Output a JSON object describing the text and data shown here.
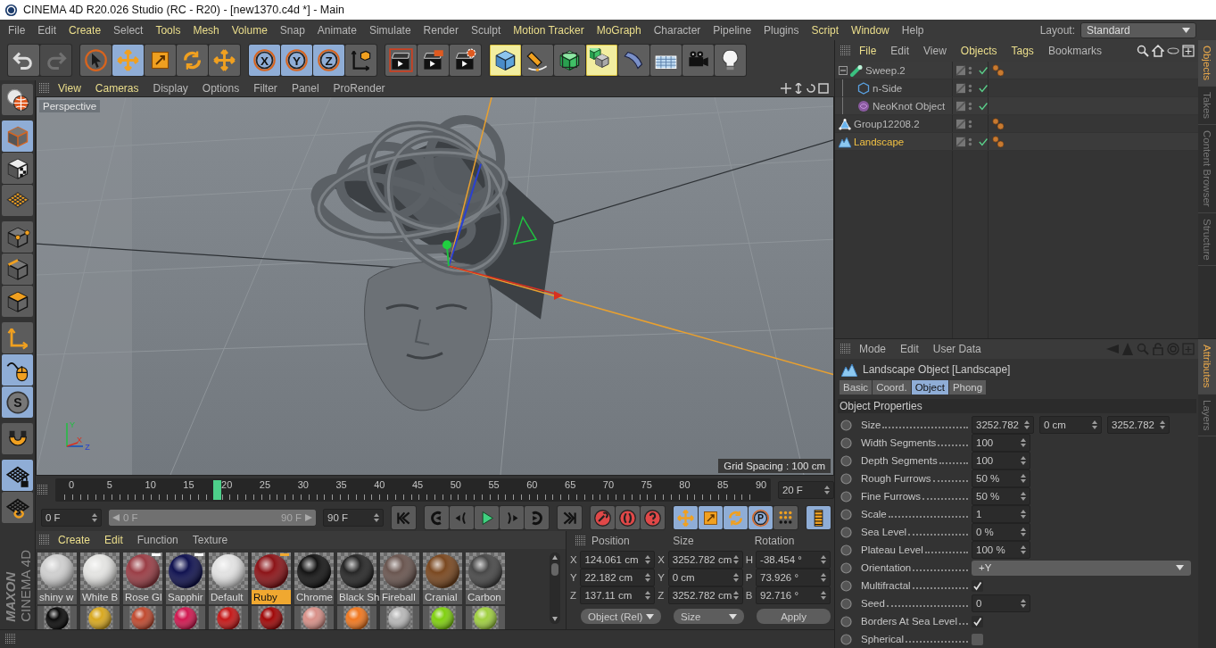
{
  "window": {
    "title": "CINEMA 4D R20.026 Studio (RC - R20) - [new1370.c4d *] - Main"
  },
  "menu_bar": {
    "items": [
      {
        "label": "File",
        "highlight": false
      },
      {
        "label": "Edit",
        "highlight": false
      },
      {
        "label": "Create",
        "highlight": true
      },
      {
        "label": "Select",
        "highlight": false
      },
      {
        "label": "Tools",
        "highlight": true
      },
      {
        "label": "Mesh",
        "highlight": true
      },
      {
        "label": "Volume",
        "highlight": true
      },
      {
        "label": "Snap",
        "highlight": false
      },
      {
        "label": "Animate",
        "highlight": false
      },
      {
        "label": "Simulate",
        "highlight": false
      },
      {
        "label": "Render",
        "highlight": false
      },
      {
        "label": "Sculpt",
        "highlight": false
      },
      {
        "label": "Motion Tracker",
        "highlight": true
      },
      {
        "label": "MoGraph",
        "highlight": true
      },
      {
        "label": "Character",
        "highlight": false
      },
      {
        "label": "Pipeline",
        "highlight": false
      },
      {
        "label": "Plugins",
        "highlight": false
      },
      {
        "label": "Script",
        "highlight": true
      },
      {
        "label": "Window",
        "highlight": true
      },
      {
        "label": "Help",
        "highlight": false
      }
    ],
    "layout_label": "Layout:",
    "layout_value": "Standard"
  },
  "toolbar": {
    "groups": [
      [
        {
          "kind": "undo",
          "selected": false,
          "highlighted": false,
          "disabled": false
        },
        {
          "kind": "redo",
          "selected": false,
          "highlighted": false,
          "disabled": true
        }
      ],
      [
        {
          "kind": "select",
          "selected": false,
          "highlighted": false,
          "disabled": false
        },
        {
          "kind": "move",
          "selected": true,
          "highlighted": false,
          "disabled": false
        },
        {
          "kind": "scale",
          "selected": false,
          "highlighted": false,
          "disabled": false
        },
        {
          "kind": "rotate",
          "selected": false,
          "highlighted": false,
          "disabled": false
        },
        {
          "kind": "recent",
          "selected": false,
          "highlighted": false,
          "disabled": false
        }
      ],
      [
        {
          "kind": "axis",
          "label": "X",
          "selected": true,
          "highlighted": false,
          "disabled": false
        },
        {
          "kind": "axis",
          "label": "Y",
          "selected": true,
          "highlighted": false,
          "disabled": false
        },
        {
          "kind": "axis",
          "label": "Z",
          "selected": true,
          "highlighted": false,
          "disabled": false
        },
        {
          "kind": "coords",
          "selected": false,
          "highlighted": false,
          "disabled": false
        }
      ],
      [
        {
          "kind": "renderview",
          "selected": false,
          "highlighted": false,
          "disabled": false
        },
        {
          "kind": "render",
          "selected": false,
          "highlighted": false,
          "disabled": false
        },
        {
          "kind": "rendersettings",
          "selected": false,
          "highlighted": false,
          "disabled": false
        }
      ],
      [
        {
          "kind": "cube",
          "selected": false,
          "highlighted": true,
          "disabled": false
        },
        {
          "kind": "pen",
          "selected": false,
          "highlighted": false,
          "disabled": false
        },
        {
          "kind": "subdiv",
          "selected": false,
          "highlighted": false,
          "disabled": false
        },
        {
          "kind": "cloner",
          "selected": false,
          "highlighted": true,
          "disabled": false
        },
        {
          "kind": "deformer",
          "selected": false,
          "highlighted": false,
          "disabled": false
        },
        {
          "kind": "floor",
          "selected": false,
          "highlighted": false,
          "disabled": false
        },
        {
          "kind": "camera",
          "selected": false,
          "highlighted": false,
          "disabled": false
        },
        {
          "kind": "light",
          "selected": false,
          "highlighted": false,
          "disabled": false
        }
      ]
    ]
  },
  "left_toolbar": {
    "groups": [
      [
        {
          "kind": "editable",
          "selected": false
        }
      ],
      [
        {
          "kind": "model",
          "selected": true
        },
        {
          "kind": "texture",
          "selected": false
        },
        {
          "kind": "workplane",
          "selected": false
        }
      ],
      [
        {
          "kind": "points",
          "selected": false
        },
        {
          "kind": "edges",
          "selected": false
        },
        {
          "kind": "polygons",
          "selected": false
        }
      ],
      [
        {
          "kind": "axismode",
          "selected": false
        },
        {
          "kind": "tweak",
          "selected": true
        },
        {
          "kind": "solo",
          "label": "S",
          "selected": true
        }
      ],
      [
        {
          "kind": "snap",
          "selected": false
        }
      ],
      [
        {
          "kind": "lockplane",
          "selected": true
        },
        {
          "kind": "alignplane",
          "selected": false
        }
      ]
    ]
  },
  "logo": {
    "brand": "MAXON",
    "product": "CINEMA 4D"
  },
  "viewport": {
    "menu": [
      {
        "label": "View",
        "highlight": true
      },
      {
        "label": "Cameras",
        "highlight": true
      },
      {
        "label": "Display",
        "highlight": false
      },
      {
        "label": "Options",
        "highlight": false
      },
      {
        "label": "Filter",
        "highlight": false
      },
      {
        "label": "Panel",
        "highlight": false
      },
      {
        "label": "ProRender",
        "highlight": false
      }
    ],
    "camera": "Perspective",
    "axis_labels": [
      "Y",
      "X",
      "Z"
    ],
    "grid_spacing": "Grid Spacing : 100 cm"
  },
  "timeline": {
    "ticks": [
      "0",
      "5",
      "10",
      "15",
      "20",
      "25",
      "30",
      "35",
      "40",
      "45",
      "50",
      "55",
      "60",
      "65",
      "70",
      "75",
      "80",
      "85",
      "90"
    ],
    "playhead": {
      "level": 0.2222
    },
    "current_frame": "20 F"
  },
  "transport": {
    "start_field": "0 F",
    "range_start": "0 F",
    "range_end": "90 F",
    "range": {
      "level": 1
    },
    "end_field": "90 F",
    "groups": [
      [
        {
          "kind": "gostart",
          "selected": false
        }
      ],
      [
        {
          "kind": "prevkey",
          "selected": false
        },
        {
          "kind": "prevframe",
          "selected": false
        },
        {
          "kind": "play",
          "selected": false
        },
        {
          "kind": "nextframe",
          "selected": false
        },
        {
          "kind": "nextkey",
          "selected": false
        }
      ],
      [
        {
          "kind": "goend",
          "selected": false
        }
      ],
      [
        {
          "kind": "record",
          "selected": false
        },
        {
          "kind": "autokey",
          "selected": false
        },
        {
          "kind": "keyselection",
          "selected": false
        }
      ],
      [
        {
          "kind": "keymove",
          "selected": true
        },
        {
          "kind": "keyscale",
          "selected": true
        },
        {
          "kind": "keyrotate",
          "selected": true
        },
        {
          "kind": "keyparam",
          "label": "P",
          "selected": true
        },
        {
          "kind": "keypla",
          "selected": false
        }
      ],
      [
        {
          "kind": "film",
          "selected": true
        }
      ]
    ]
  },
  "materials": {
    "menu": [
      {
        "label": "Create",
        "highlight": true
      },
      {
        "label": "Edit",
        "highlight": true
      },
      {
        "label": "Function",
        "highlight": false
      },
      {
        "label": "Texture",
        "highlight": false
      }
    ],
    "items": [
      {
        "name": "shiny w",
        "color": "#cfcfcf",
        "selected": false,
        "marked": false
      },
      {
        "name": "White B",
        "color": "#e4e4e2",
        "selected": false,
        "marked": false
      },
      {
        "name": "Rose Gl",
        "color": "#9a3e46",
        "selected": false,
        "marked": true
      },
      {
        "name": "Sapphir",
        "color": "#101250",
        "selected": false,
        "marked": true
      },
      {
        "name": "Default",
        "color": "#e2e2e2",
        "selected": false,
        "marked": false
      },
      {
        "name": "Ruby",
        "color": "#8c1418",
        "selected": true,
        "marked": true
      },
      {
        "name": "Chrome",
        "color": "#141414",
        "selected": false,
        "marked": false
      },
      {
        "name": "Black Sh",
        "color": "#262626",
        "selected": false,
        "marked": false
      },
      {
        "name": "Fireball",
        "color": "#6a5650",
        "selected": false,
        "marked": false
      },
      {
        "name": "Cranial",
        "color": "#7a4820",
        "selected": false,
        "marked": false
      },
      {
        "name": "Carbon",
        "color": "#484848",
        "selected": false,
        "marked": false
      }
    ],
    "more_items": [
      {
        "color": "#0a0a0a"
      },
      {
        "color": "#d8a820"
      },
      {
        "color": "#c04a30"
      },
      {
        "color": "#d01850"
      },
      {
        "color": "#c41818"
      },
      {
        "color": "#a00808"
      },
      {
        "color": "#d89088"
      },
      {
        "color": "#f07820"
      },
      {
        "color": "#b8b8b8"
      },
      {
        "color": "#80d010"
      },
      {
        "color": "#a0d040"
      }
    ]
  },
  "coordinates": {
    "headers": [
      "Position",
      "Size",
      "Rotation"
    ],
    "rows": [
      [
        {
          "axis": "X",
          "value": "124.061 cm"
        },
        {
          "axis": "X",
          "value": "3252.782 cm"
        },
        {
          "axis": "H",
          "value": "-38.454 °"
        }
      ],
      [
        {
          "axis": "Y",
          "value": "22.182 cm"
        },
        {
          "axis": "Y",
          "value": "0 cm"
        },
        {
          "axis": "P",
          "value": "73.926 °"
        }
      ],
      [
        {
          "axis": "Z",
          "value": "137.11 cm"
        },
        {
          "axis": "Z",
          "value": "3252.782 cm"
        },
        {
          "axis": "B",
          "value": "92.716 °"
        }
      ]
    ],
    "mode": "Object (Rel)",
    "size_mode": "Size",
    "apply": "Apply"
  },
  "object_manager": {
    "menu": [
      {
        "label": "File",
        "highlight": true
      },
      {
        "label": "Edit",
        "highlight": false
      },
      {
        "label": "View",
        "highlight": false
      },
      {
        "label": "Objects",
        "highlight": true
      },
      {
        "label": "Tags",
        "highlight": true
      },
      {
        "label": "Bookmarks",
        "highlight": false
      }
    ],
    "objects": [
      {
        "name": "Sweep.2",
        "kind": "sweep",
        "selected": false,
        "enabled": true,
        "tag": true,
        "expanded": true,
        "children": [
          {
            "name": "n-Side",
            "kind": "spline",
            "selected": false,
            "enabled": true,
            "tag": false
          },
          {
            "name": "NeoKnot Object",
            "kind": "knot",
            "selected": false,
            "enabled": true,
            "tag": false
          }
        ]
      },
      {
        "name": "Group12208.2",
        "kind": "group",
        "selected": false,
        "enabled": false,
        "tag": true
      },
      {
        "name": "Landscape",
        "kind": "landscape",
        "selected": true,
        "enabled": true,
        "tag": true
      }
    ],
    "side_tabs": [
      {
        "label": "Objects",
        "selected": true
      },
      {
        "label": "Takes",
        "selected": false
      },
      {
        "label": "Content Browser",
        "selected": false
      },
      {
        "label": "Structure",
        "selected": false
      }
    ]
  },
  "attributes": {
    "menu": [
      {
        "label": "Mode",
        "highlight": false
      },
      {
        "label": "Edit",
        "highlight": false
      },
      {
        "label": "User Data",
        "highlight": false
      }
    ],
    "title": "Landscape Object [Landscape]",
    "tabs": [
      {
        "label": "Basic",
        "selected": false
      },
      {
        "label": "Coord.",
        "selected": false
      },
      {
        "label": "Object",
        "selected": true
      },
      {
        "label": "Phong",
        "selected": false
      }
    ],
    "section": "Object Properties",
    "properties": [
      {
        "label": "Size",
        "kind": "vector",
        "values": [
          "3252.782",
          "0 cm",
          "3252.782"
        ]
      },
      {
        "label": "Width Segments",
        "kind": "number",
        "value": "100"
      },
      {
        "label": "Depth Segments",
        "kind": "number",
        "value": "100"
      },
      {
        "label": "Rough Furrows",
        "kind": "number",
        "value": "50 %"
      },
      {
        "label": "Fine Furrows",
        "kind": "number",
        "value": "50 %"
      },
      {
        "label": "Scale",
        "kind": "number",
        "value": "1"
      },
      {
        "label": "Sea Level",
        "kind": "number",
        "value": "0 %"
      },
      {
        "label": "Plateau Level",
        "kind": "number",
        "value": "100 %"
      },
      {
        "label": "Orientation",
        "kind": "dropdown",
        "value": "+Y"
      },
      {
        "label": "Multifractal",
        "kind": "checkbox",
        "checked": true
      },
      {
        "label": "Seed",
        "kind": "number",
        "value": "0"
      },
      {
        "label": "Borders At Sea Level",
        "kind": "checkbox",
        "checked": true
      },
      {
        "label": "Spherical",
        "kind": "checkbox",
        "checked": false
      }
    ],
    "side_tabs": [
      {
        "label": "Attributes",
        "selected": true
      },
      {
        "label": "Layers",
        "selected": false
      }
    ]
  }
}
